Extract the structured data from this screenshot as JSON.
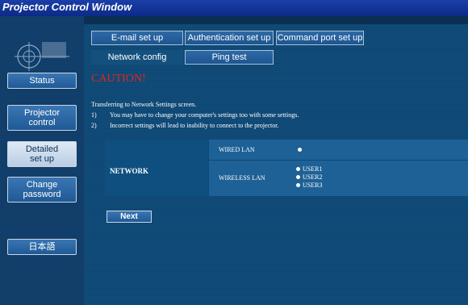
{
  "window": {
    "title": "Projector Control Window"
  },
  "sidebar": {
    "items": [
      {
        "label": "Status"
      },
      {
        "label": "Projector\ncontrol"
      },
      {
        "label": "Detailed\nset up"
      },
      {
        "label": "Change\npassword"
      },
      {
        "label": "日本語"
      }
    ],
    "active_index": 2
  },
  "tabs": {
    "row1": [
      "E-mail set up",
      "Authentication set up",
      "Command port set up"
    ],
    "row2": [
      "Network config",
      "Ping test"
    ],
    "selected": "Network config"
  },
  "content": {
    "caution": "CAUTION!",
    "intro": "Transferring to Network Settings screen.",
    "notes": [
      {
        "num": "1)",
        "text": "You may have to change your computer's settings too with some settings."
      },
      {
        "num": "2)",
        "text": "Incorrect settings will lead to inability to connect to the projector."
      }
    ]
  },
  "network": {
    "label": "NETWORK",
    "wired_label": "WIRED LAN",
    "wireless_label": "WIRELESS LAN",
    "wireless_options": [
      "USER1",
      "USER2",
      "USER3"
    ],
    "selected_wireless": "USER1"
  },
  "actions": {
    "next_label": "Next"
  },
  "colors": {
    "titlebar": "#0c2a88",
    "background": "#0b2f52",
    "caution": "#e0261e"
  }
}
